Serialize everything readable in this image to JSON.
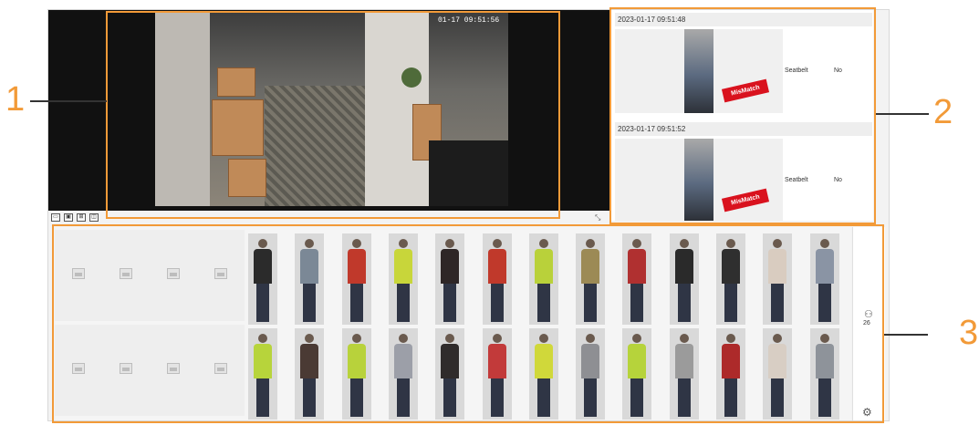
{
  "video": {
    "osd_time": "01-17 09:51:56",
    "toolbar_icons": [
      "split-view-icon",
      "fullscreen-icon",
      "zoom-icon",
      "snapshot-icon"
    ]
  },
  "detections": [
    {
      "time": "2023-01-17 09:51:48",
      "badge": "MisMatch",
      "attr_label": "Seatbelt",
      "attr_value": "No"
    },
    {
      "time": "2023-01-17 09:51:52",
      "badge": "MisMatch",
      "attr_label": "Seatbelt",
      "attr_value": "No"
    }
  ],
  "grid": {
    "count": "26",
    "row1_colors": [
      "#2b2b2b",
      "#7b8896",
      "#c0392b",
      "#c8d63a",
      "#2e2626",
      "#c0392b",
      "#b9d13a",
      "#9c8a55",
      "#b03030",
      "#2a2a2a",
      "#2f2f2f",
      "#d9ccc0",
      "#8a94a4"
    ],
    "row2_colors": [
      "#b7d43b",
      "#4a3a34",
      "#b8d23b",
      "#9c9fa8",
      "#2f2b2b",
      "#c23a3a",
      "#d0d83a",
      "#8e8f93",
      "#b6d33b",
      "#9b9b9b",
      "#ad2a2a",
      "#d8cec4",
      "#8e939a"
    ]
  },
  "callouts": [
    "1",
    "2",
    "3"
  ],
  "colors": {
    "accent": "#f29a38",
    "mismatch": "#d9121e"
  }
}
